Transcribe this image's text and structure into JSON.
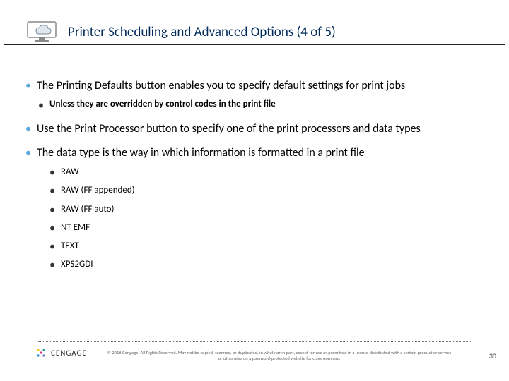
{
  "header": {
    "title": "Printer Scheduling and Advanced Options (4 of 5)",
    "icon": "cloud-monitor-icon"
  },
  "bullets": {
    "b1": "The Printing Defaults button enables you to specify default settings for print jobs",
    "b1a": "Unless they are overridden by control codes in the print file",
    "b2": "Use the Print Processor button to specify one of the print processors and data types",
    "b3": "The data type is the way in which information is formatted in a print file",
    "b3_items": {
      "i1": "RAW",
      "i2": "RAW (FF appended)",
      "i3": "RAW (FF auto)",
      "i4": "NT EMF",
      "i5": "TEXT",
      "i6": "XPS2GDI"
    }
  },
  "footer": {
    "brand": "CENGAGE",
    "copyright": "© 2018 Cengage. All Rights Reserved. May not be copied, scanned, or duplicated, in whole or in part, except for use as permitted in a license distributed with a certain product or service or otherwise on a password-protected website for classroom use.",
    "page": "30"
  }
}
